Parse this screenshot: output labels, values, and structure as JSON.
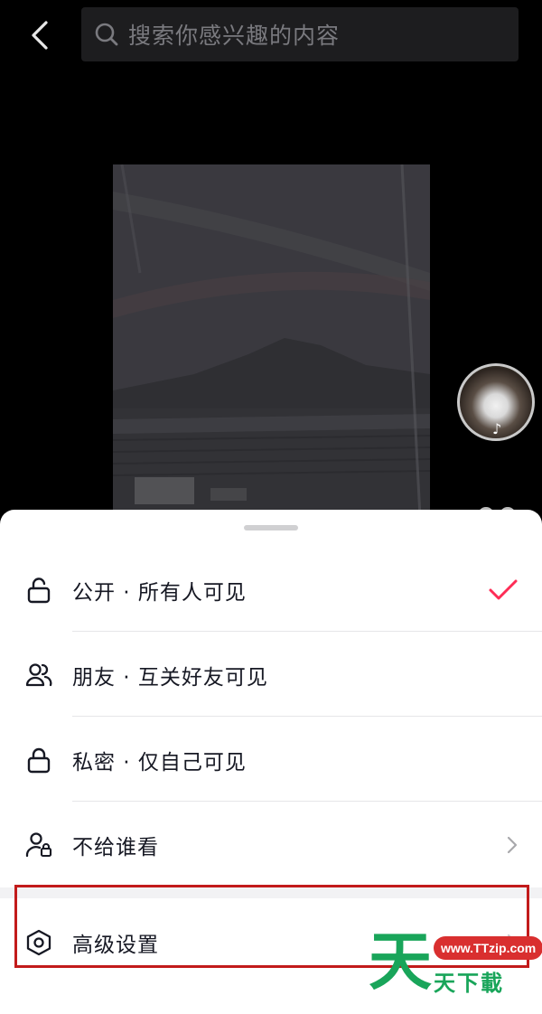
{
  "header": {
    "back_icon": "chevron-left-icon",
    "search_icon": "search-icon",
    "search_placeholder": "搜索你感兴趣的内容"
  },
  "visibility_options": [
    {
      "icon": "lock-open-icon",
      "label": "公开 · 所有人可见",
      "trailing": "check-icon",
      "selected": true
    },
    {
      "icon": "friends-icon",
      "label": "朋友 · 互关好友可见",
      "trailing": "",
      "selected": false
    },
    {
      "icon": "lock-icon",
      "label": "私密 · 仅自己可见",
      "trailing": "",
      "selected": false
    },
    {
      "icon": "user-block-icon",
      "label": "不给谁看",
      "trailing": "chevron-right-icon",
      "selected": false
    }
  ],
  "advanced": {
    "icon": "hexagon-settings-icon",
    "label": "高级设置",
    "trailing": "chevron-right-icon"
  },
  "watermark": {
    "big_char": "天",
    "url": "www.TTzip.com",
    "text": "天下載"
  },
  "colors": {
    "accent_check": "#fe2c55",
    "highlight_border": "#c21b1b",
    "watermark_green": "#19a55a",
    "watermark_red": "#d92f2f"
  }
}
